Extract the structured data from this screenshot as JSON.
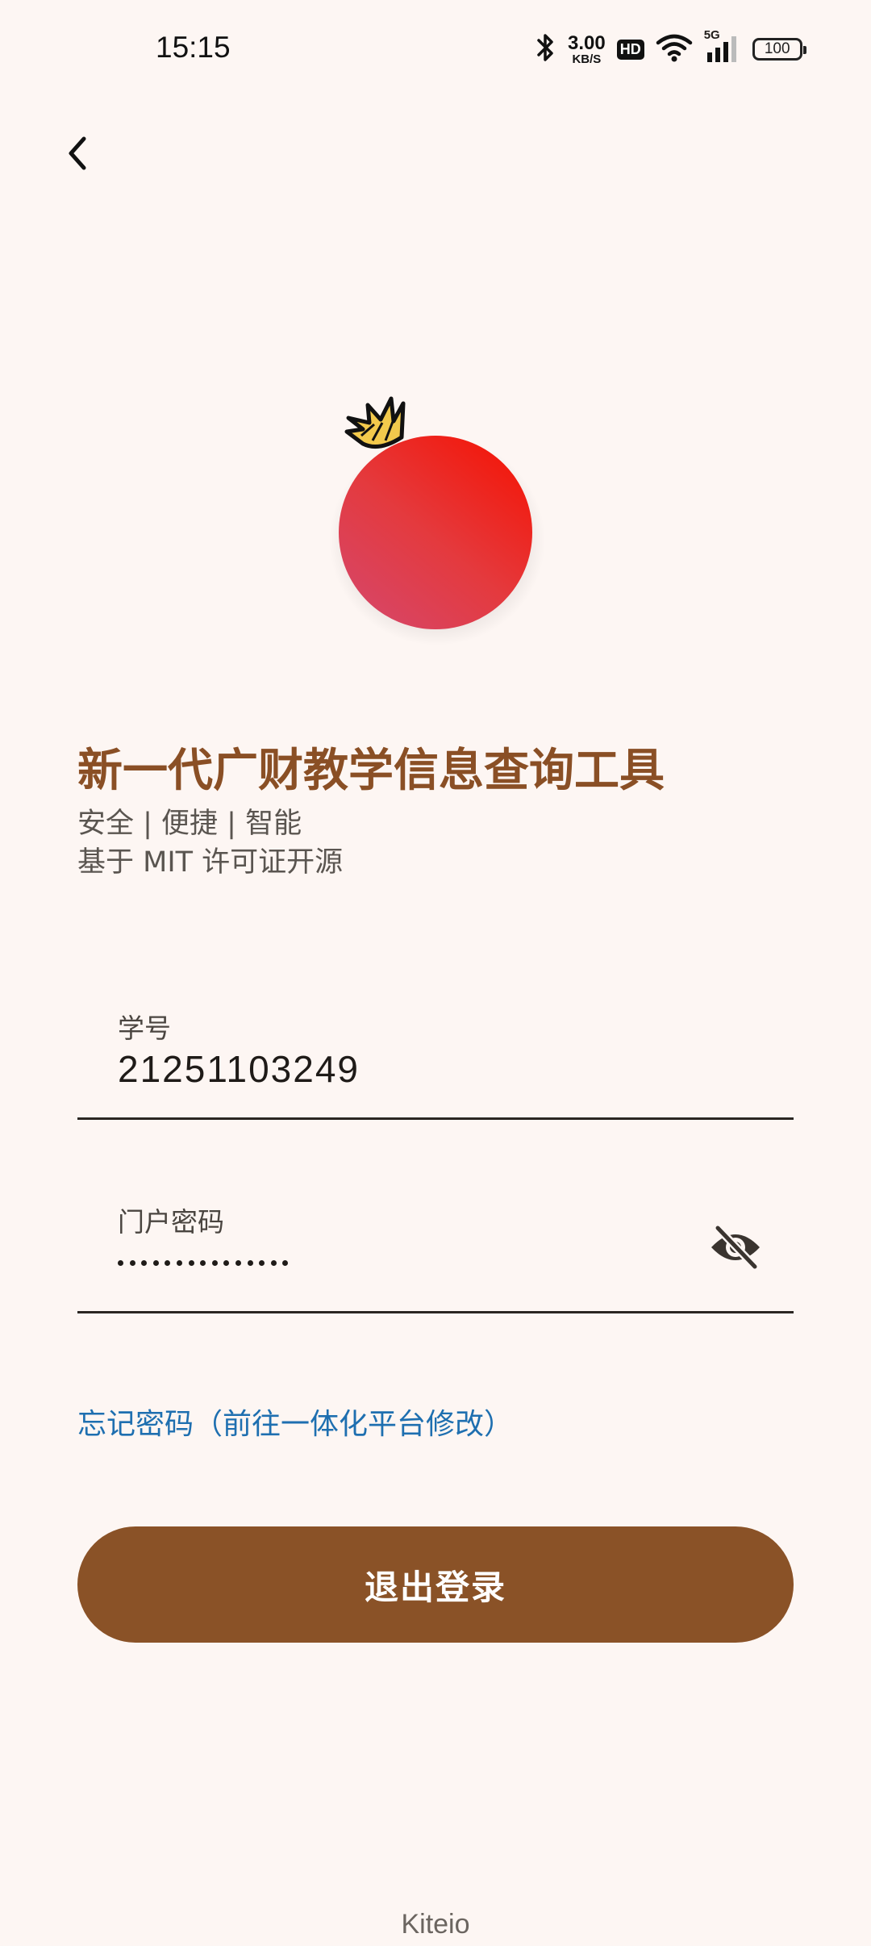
{
  "status_bar": {
    "time": "15:15",
    "net_speed_value": "3.00",
    "net_speed_unit": "KB/S",
    "hd_badge": "HD",
    "network_type": "5G",
    "battery": "100",
    "icons": [
      "bluetooth-icon",
      "wifi-icon",
      "signal-icon",
      "battery-icon"
    ]
  },
  "header": {
    "back_icon": "chevron-left-icon"
  },
  "app": {
    "title": "新一代广财教学信息查询工具",
    "tagline": "安全 | 便捷 | 智能",
    "license": "基于 MIT 许可证开源"
  },
  "form": {
    "student_id_label": "学号",
    "student_id_value": "21251103249",
    "password_label": "门户密码",
    "password_length": 15,
    "visibility_icon": "eye-off-icon",
    "forgot_link": "忘记密码（前往一体化平台修改）",
    "logout_button": "退出登录"
  },
  "footer": {
    "brand": "Kiteio"
  },
  "colors": {
    "background": "#FDF6F3",
    "primary": "#8A5227",
    "title": "#8A4F25",
    "link": "#1E6FB0"
  }
}
